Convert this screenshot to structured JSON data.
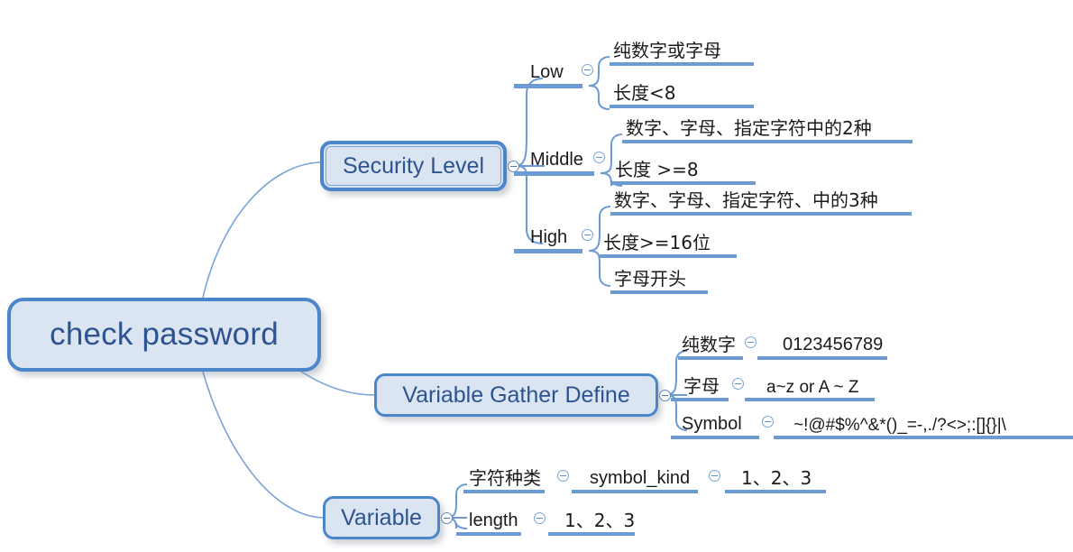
{
  "diagram": {
    "type": "mind-map",
    "title": "check password",
    "colors": {
      "topic_fill": "#dbe5f1",
      "topic_border": "#4a86c8",
      "topic_text": "#2d5490",
      "branch_line": "#6b9bd2",
      "connector_line": "#7aa4d6",
      "leaf_text": "#1a1a1a",
      "background": "#ffffff"
    },
    "root": {
      "label": "check password"
    },
    "branches": [
      {
        "id": "security-level",
        "label": "Security Level",
        "handle": "collapse-handle",
        "children": [
          {
            "id": "low",
            "label": "Low",
            "handle": "collapse-handle",
            "children": [
              {
                "id": "low-1",
                "label": "纯数字或字母"
              },
              {
                "id": "low-2",
                "label": "长度<8"
              }
            ]
          },
          {
            "id": "middle",
            "label": "Middle",
            "handle": "collapse-handle",
            "children": [
              {
                "id": "middle-1",
                "label": "数字、字母、指定字符中的2种"
              },
              {
                "id": "middle-2",
                "label": "长度 >=8"
              }
            ]
          },
          {
            "id": "high",
            "label": "High",
            "handle": "collapse-handle",
            "children": [
              {
                "id": "high-1",
                "label": "数字、字母、指定字符、中的3种"
              },
              {
                "id": "high-2",
                "label": "长度>=16位"
              },
              {
                "id": "high-3",
                "label": "字母开头"
              }
            ]
          }
        ]
      },
      {
        "id": "variable-gather-define",
        "label": "Variable Gather Define",
        "handle": "collapse-handle",
        "children": [
          {
            "id": "pure-digits",
            "label": "纯数字",
            "handle": "collapse-handle",
            "children": [
              {
                "id": "pure-digits-v",
                "label": "0123456789"
              }
            ]
          },
          {
            "id": "letters",
            "label": "字母",
            "handle": "collapse-handle",
            "children": [
              {
                "id": "letters-v",
                "label": "a~z or A ~ Z"
              }
            ]
          },
          {
            "id": "symbol",
            "label": "Symbol",
            "handle": "collapse-handle",
            "children": [
              {
                "id": "symbol-v",
                "label": "~!@#$%^&*()_=-,./?<>;:[]{}|\\"
              }
            ]
          }
        ]
      },
      {
        "id": "variable",
        "label": "Variable",
        "handle": "collapse-handle",
        "children": [
          {
            "id": "char-kind",
            "label": "字符种类",
            "handle": "collapse-handle",
            "children": [
              {
                "id": "symbol-kind",
                "label": "symbol_kind",
                "handle": "collapse-handle",
                "children": [
                  {
                    "id": "symbol-kind-v",
                    "label": "1、2、3"
                  }
                ]
              }
            ]
          },
          {
            "id": "length",
            "label": "length",
            "handle": "collapse-handle",
            "children": [
              {
                "id": "length-v",
                "label": "1、2、3"
              }
            ]
          }
        ]
      }
    ]
  }
}
